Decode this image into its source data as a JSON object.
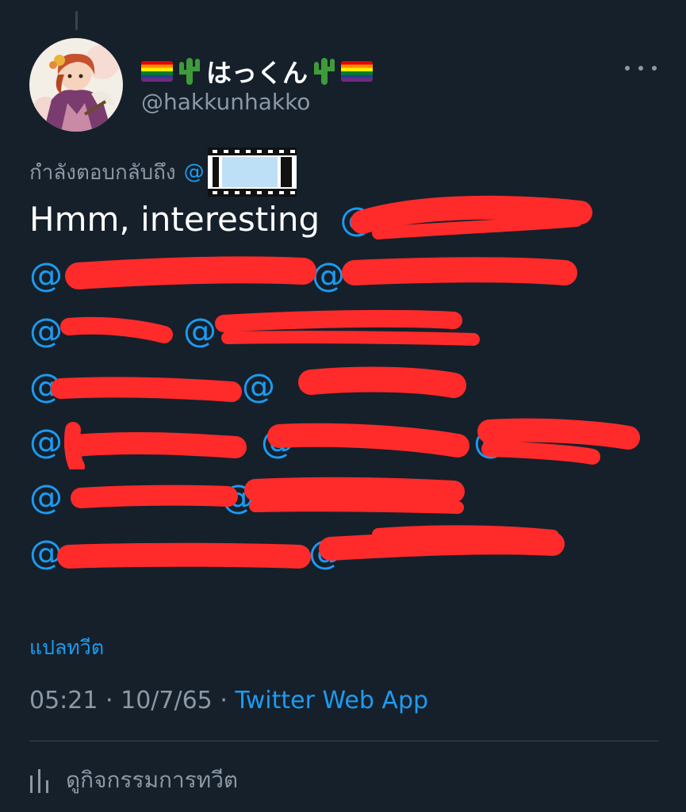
{
  "tweet": {
    "display_name": "はっくん",
    "handle": "@hakkunhakko",
    "reply_prefix": "กำลังตอบกลับถึง",
    "reply_mention": "@",
    "text": "Hmm, interesting",
    "mention_lines": [
      [
        "@"
      ],
      [
        "@",
        "@"
      ],
      [
        "@",
        "@"
      ],
      [
        "@",
        "@"
      ],
      [
        "@",
        "@",
        "@"
      ],
      [
        "@",
        "@"
      ],
      [
        "@",
        "@"
      ]
    ],
    "translate_label": "แปลทวีต",
    "time": "05:21",
    "date": "10/7/65",
    "separator": "·",
    "source": "Twitter Web App",
    "activity_label": "ดูกิจกรรมการทวีต"
  },
  "icons": {
    "name_prefix": [
      "rainbow-flag-icon",
      "cactus-icon"
    ],
    "name_suffix": [
      "cactus-icon",
      "rainbow-flag-icon"
    ],
    "more": "more-dots-icon",
    "reply_sticker": "film-strip-icon",
    "activity": "analytics-icon"
  },
  "colors": {
    "background": "#15202b",
    "link": "#1d9bf0",
    "secondary_text": "#8b98a5",
    "divider": "#38444d",
    "redaction": "#ff2b2b"
  }
}
